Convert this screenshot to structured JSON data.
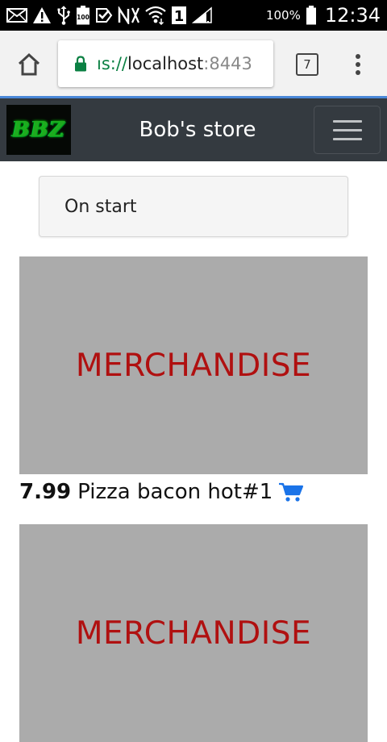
{
  "status_bar": {
    "battery_percent": "100%",
    "time": "12:34",
    "notification_badge": "1",
    "battery_icon_label": "100",
    "icons": [
      "mail-icon",
      "warning-icon",
      "usb-icon",
      "battery-100-icon",
      "check-icon",
      "nfc-icon",
      "wifi-icon",
      "sim-1-icon",
      "signal-icon",
      "battery-icon"
    ]
  },
  "browser": {
    "url_scheme": "ıs://",
    "url_host": "localhost",
    "url_port": ":8443",
    "tab_count": "7",
    "url_scheme_color": "#0b8043"
  },
  "navbar": {
    "logo_text": "BBZ",
    "brand": "Bob's store",
    "background": "#343a40"
  },
  "main": {
    "on_start_label": "On start",
    "products": [
      {
        "placeholder": "MERCHANDISE",
        "price": "7.99",
        "name": "Pizza bacon hot#1"
      },
      {
        "placeholder": "MERCHANDISE"
      }
    ],
    "placeholder_color": "#b01010",
    "cart_icon_color": "#1a73e8"
  }
}
